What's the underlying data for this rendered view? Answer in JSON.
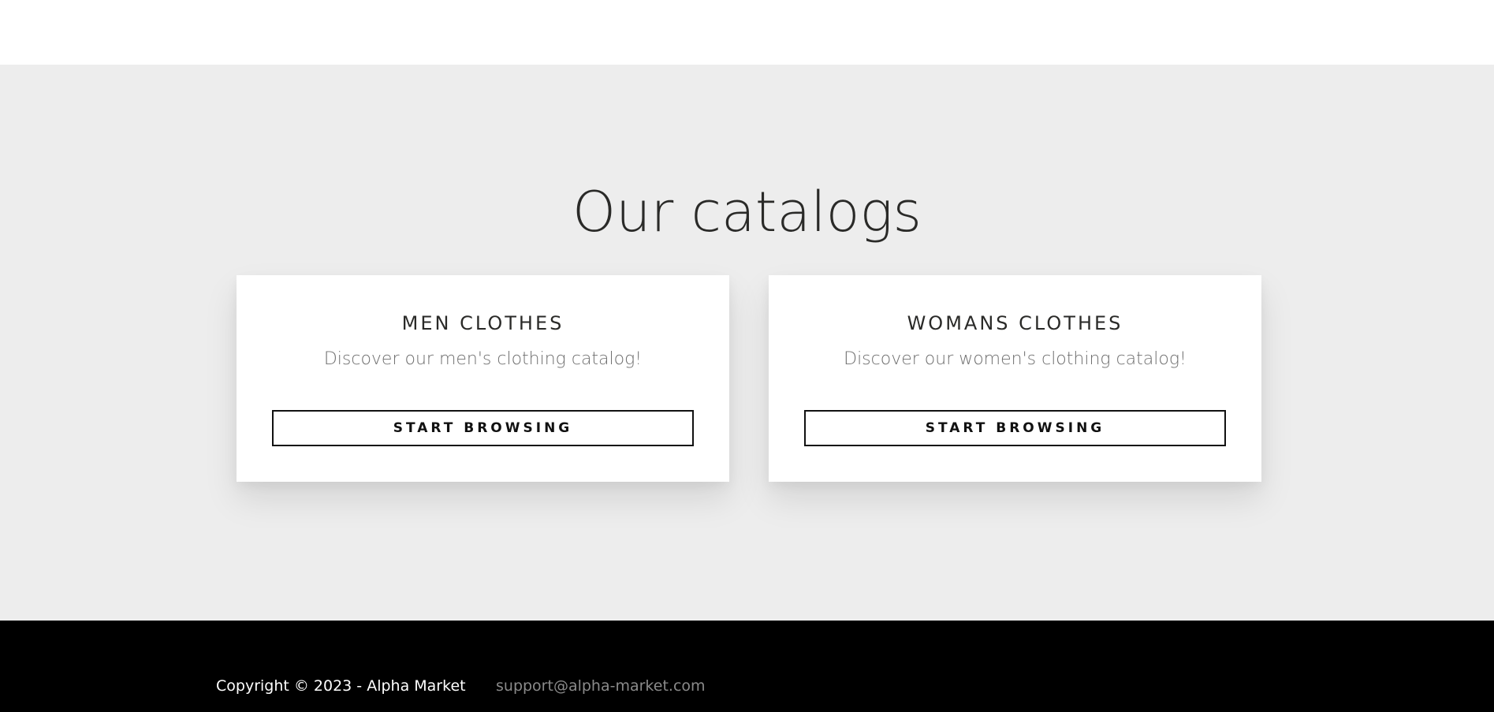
{
  "catalogs": {
    "title": "Our catalogs",
    "cards": [
      {
        "title": "MEN CLOTHES",
        "description": "Discover our men's clothing catalog!",
        "button_label": "START BROWSING"
      },
      {
        "title": "WOMANS CLOTHES",
        "description": "Discover our women's clothing catalog!",
        "button_label": "START BROWSING"
      }
    ]
  },
  "footer": {
    "copyright": "Copyright ©  2023 - Alpha Market",
    "email": "support@alpha-market.com"
  },
  "colors": {
    "section_background": "#ededed",
    "footer_background": "#000000",
    "card_background": "#ffffff",
    "heading_text": "#2a2a28",
    "muted_text": "#6f6f6f",
    "email_text": "#8a8a8a"
  }
}
